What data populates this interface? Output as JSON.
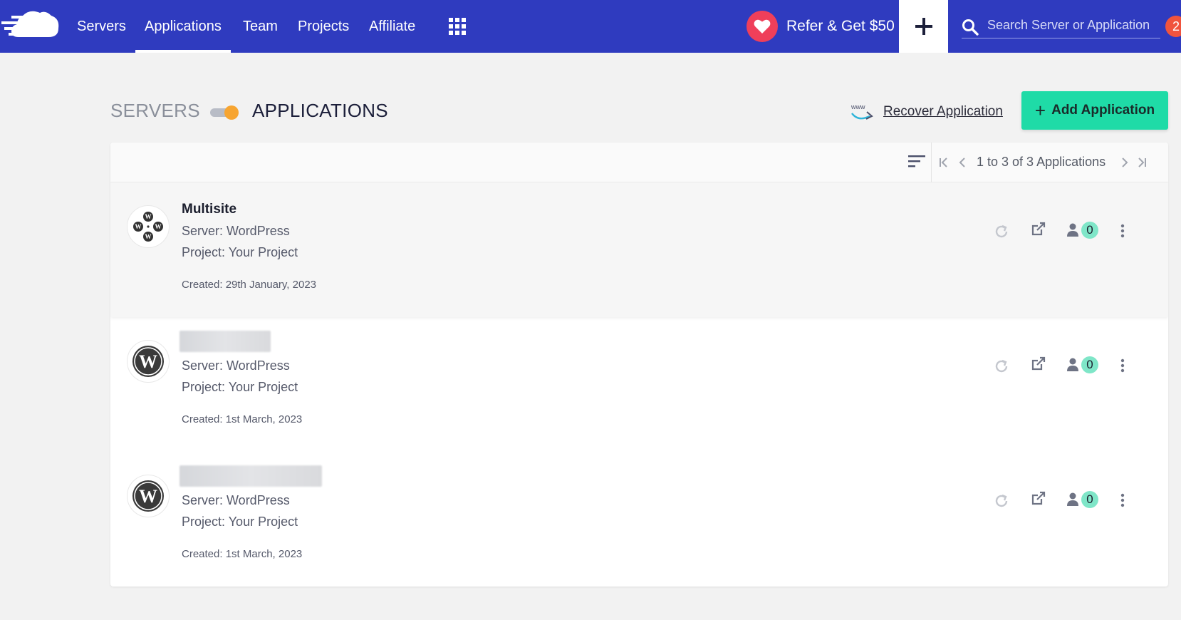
{
  "nav": {
    "items": [
      {
        "label": "Servers",
        "active": false
      },
      {
        "label": "Applications",
        "active": true
      },
      {
        "label": "Team",
        "active": false
      },
      {
        "label": "Projects",
        "active": false
      },
      {
        "label": "Affiliate",
        "active": false
      }
    ],
    "refer_label": "Refer & Get $50",
    "search_placeholder": "Search Server or Application",
    "notification_count": "2"
  },
  "header": {
    "servers_label": "SERVERS",
    "applications_label": "APPLICATIONS",
    "recover_label": "Recover Application",
    "add_label": "Add Application"
  },
  "pagination": {
    "text": "1 to 3 of 3 Applications"
  },
  "applications": [
    {
      "name": "Multisite",
      "name_blurred": false,
      "server": "Server: WordPress",
      "project": "Project: Your Project",
      "created": "Created: 29th January, 2023",
      "members": "0",
      "icon": "wordpress-multisite-icon"
    },
    {
      "name": "",
      "name_blurred": true,
      "server": "Server: WordPress",
      "project": "Project: Your Project",
      "created": "Created: 1st March, 2023",
      "members": "0",
      "icon": "wordpress-icon"
    },
    {
      "name": "",
      "name_blurred": true,
      "server": "Server: WordPress",
      "project": "Project: Your Project",
      "created": "Created: 1st March, 2023",
      "members": "0",
      "icon": "wordpress-icon"
    }
  ],
  "colors": {
    "nav_bg": "#2f3bbf",
    "accent_green": "#1fdba7",
    "toggle_orange": "#f7a531",
    "heart_red": "#ef3f5a",
    "badge_orange": "#f0543e",
    "member_badge": "#7fe6c8"
  }
}
